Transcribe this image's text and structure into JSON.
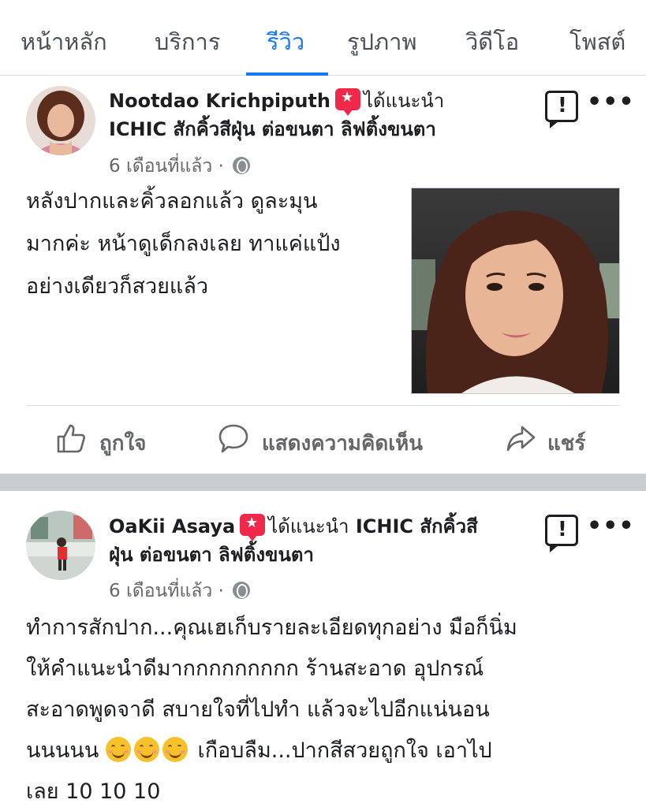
{
  "tabs": [
    {
      "label": "หน้าหลัก"
    },
    {
      "label": "บริการ"
    },
    {
      "label": "รีวิว"
    },
    {
      "label": "รูปภาพ"
    },
    {
      "label": "วิดีโอ"
    },
    {
      "label": "โพสต์"
    }
  ],
  "active_tab": "รีวิว",
  "colors": {
    "accent": "#1877f2",
    "recommend_badge": "#f0284a",
    "secondary_text": "#65676b"
  },
  "posts": [
    {
      "author": "Nootdao Krichpiputh",
      "recommends_text": "ได้แนะนำ",
      "page_name": "ICHIC สักคิ้วสีฝุ่น ต่อขนตา ลิฟติ้งขนตา",
      "time": "6 เดือนที่แล้ว",
      "meta_sep": "·",
      "body": [
        "หลังปากและคิ้วลอกแล้ว ดูละมุน",
        "มากค่ะ หน้าดูเด็กลงเลย ทาแค่แป้ง",
        "อย่างเดียวก็สวยแล้ว"
      ],
      "actions": {
        "like": "ถูกใจ",
        "comment": "แสดงความคิดเห็น",
        "share": "แชร์"
      }
    },
    {
      "author": "OaKii Asaya",
      "recommends_text": "ได้แนะนำ",
      "page_name_line1": "ICHIC สักคิ้วสี",
      "page_name_line2": "ฝุ่น ต่อขนตา ลิฟติ้งขนตา",
      "time": "6 เดือนที่แล้ว",
      "meta_sep": "·",
      "body_lines": [
        "ทำการสักปาก...คุณเฮเก็บรายละเอียดทุกอย่าง มือก็นิ่ม",
        "ให้คำแนะนำดีมากกกกกกกกก ร้านสะอาด อุปกรณ์",
        "สะอาดพูดจาดี สบายใจที่ไปทำ แล้วจะไปอีกแน่นอน",
        "นนนนน",
        "เกือบลืม...ปากสีสวยถูกใจ เอาไป",
        "เลย 10 10 10"
      ]
    }
  ]
}
